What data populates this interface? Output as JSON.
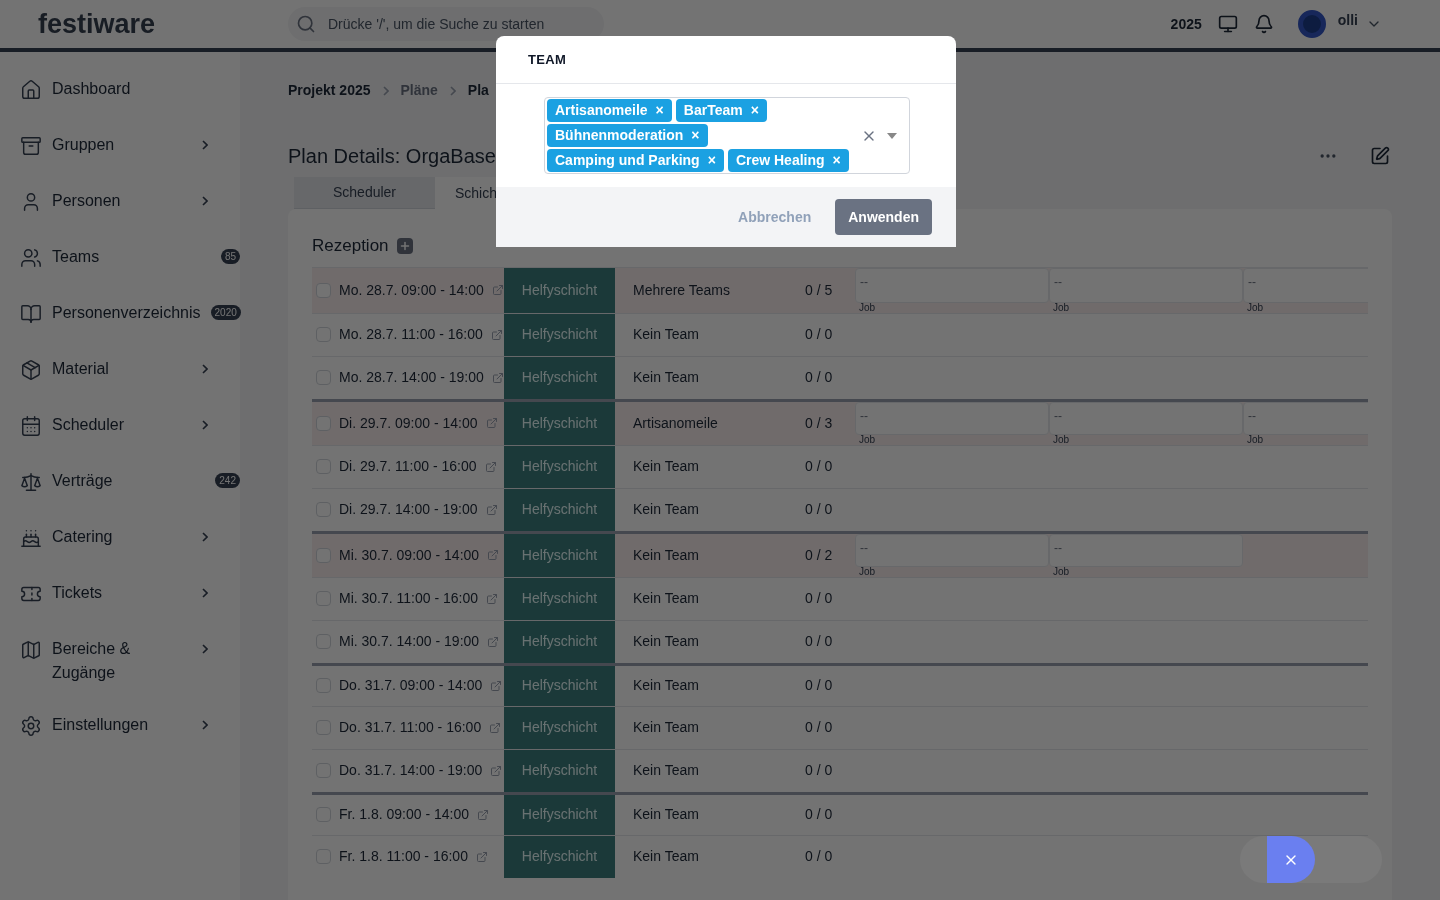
{
  "header": {
    "logo": "festiware",
    "search": {
      "placeholder": "Drücke '/', um die Suche zu starten"
    },
    "year": "2025",
    "user": "olli"
  },
  "sidebar": {
    "items": [
      {
        "label": "Dashboard",
        "kind": "link"
      },
      {
        "label": "Gruppen",
        "kind": "submenu"
      },
      {
        "label": "Personen",
        "kind": "submenu"
      },
      {
        "label": "Teams",
        "kind": "badge",
        "badge": "85"
      },
      {
        "label": "Personenverzeichnis",
        "kind": "badge",
        "badge": "2020"
      },
      {
        "label": "Material",
        "kind": "submenu"
      },
      {
        "label": "Scheduler",
        "kind": "submenu"
      },
      {
        "label": "Verträge",
        "kind": "badge",
        "badge": "242"
      },
      {
        "label": "Catering",
        "kind": "submenu"
      },
      {
        "label": "Tickets",
        "kind": "submenu"
      },
      {
        "label": "Bereiche & Zugänge",
        "kind": "submenu"
      },
      {
        "label": "Einstellungen",
        "kind": "submenu"
      }
    ]
  },
  "breadcrumb": [
    "Projekt 2025",
    "Pläne",
    "Pla"
  ],
  "page_title": "Plan Details: OrgaBase",
  "tabs": [
    {
      "label": "Scheduler",
      "selected": false
    },
    {
      "label": "Schich",
      "selected": true
    }
  ],
  "section": {
    "title": "Rezeption",
    "rows": [
      {
        "time": "Mo. 28.7. 09:00 - 14:00",
        "type": "Helfyschicht",
        "team": "Mehrere Teams",
        "count": "0 / 5",
        "checked": false,
        "group_start": false,
        "jobs": [
          {
            "value": "--",
            "label": "Job"
          },
          {
            "value": "--",
            "label": "Job"
          },
          {
            "value": "--",
            "label": "Job"
          }
        ]
      },
      {
        "time": "Mo. 28.7. 11:00 - 16:00",
        "type": "Helfyschicht",
        "team": "Kein Team",
        "count": "0 / 0",
        "checked": false,
        "group_start": false
      },
      {
        "time": "Mo. 28.7. 14:00 - 19:00",
        "type": "Helfyschicht",
        "team": "Kein Team",
        "count": "0 / 0",
        "checked": false,
        "group_start": false
      },
      {
        "time": "Di. 29.7. 09:00 - 14:00",
        "type": "Helfyschicht",
        "team": "Artisanomeile",
        "count": "0 / 3",
        "checked": false,
        "group_start": true,
        "jobs": [
          {
            "value": "--",
            "label": "Job"
          },
          {
            "value": "--",
            "label": "Job"
          },
          {
            "value": "--",
            "label": "Job"
          }
        ]
      },
      {
        "time": "Di. 29.7. 11:00 - 16:00",
        "type": "Helfyschicht",
        "team": "Kein Team",
        "count": "0 / 0",
        "checked": false,
        "group_start": false
      },
      {
        "time": "Di. 29.7. 14:00 - 19:00",
        "type": "Helfyschicht",
        "team": "Kein Team",
        "count": "0 / 0",
        "checked": false,
        "group_start": false
      },
      {
        "time": "Mi. 30.7. 09:00 - 14:00",
        "type": "Helfyschicht",
        "team": "Kein Team",
        "count": "0 / 2",
        "checked": false,
        "group_start": true,
        "jobs": [
          {
            "value": "--",
            "label": "Job"
          },
          {
            "value": "--",
            "label": "Job"
          }
        ]
      },
      {
        "time": "Mi. 30.7. 11:00 - 16:00",
        "type": "Helfyschicht",
        "team": "Kein Team",
        "count": "0 / 0",
        "checked": false,
        "group_start": false
      },
      {
        "time": "Mi. 30.7. 14:00 - 19:00",
        "type": "Helfyschicht",
        "team": "Kein Team",
        "count": "0 / 0",
        "checked": false,
        "group_start": false
      },
      {
        "time": "Do. 31.7. 09:00 - 14:00",
        "type": "Helfyschicht",
        "team": "Kein Team",
        "count": "0 / 0",
        "checked": false,
        "group_start": true
      },
      {
        "time": "Do. 31.7. 11:00 - 16:00",
        "type": "Helfyschicht",
        "team": "Kein Team",
        "count": "0 / 0",
        "checked": false,
        "group_start": false
      },
      {
        "time": "Do. 31.7. 14:00 - 19:00",
        "type": "Helfyschicht",
        "team": "Kein Team",
        "count": "0 / 0",
        "checked": false,
        "group_start": false
      },
      {
        "time": "Fr. 1.8. 09:00 - 14:00",
        "type": "Helfyschicht",
        "team": "Kein Team",
        "count": "0 / 0",
        "checked": false,
        "group_start": true
      },
      {
        "time": "Fr. 1.8. 11:00 - 16:00",
        "type": "Helfyschicht",
        "team": "Kein Team",
        "count": "0 / 0",
        "checked": false,
        "group_start": false
      }
    ]
  },
  "dialog": {
    "title": "TEAM",
    "tags": [
      "Artisanomeile",
      "BarTeam",
      "Bühnenmoderation",
      "Camping und Parking",
      "Crew Healing"
    ],
    "tag_remove": "×",
    "buttons": [
      {
        "label": "Abbrechen",
        "kind": "secondary"
      },
      {
        "label": "Anwenden",
        "kind": "primary"
      }
    ]
  }
}
